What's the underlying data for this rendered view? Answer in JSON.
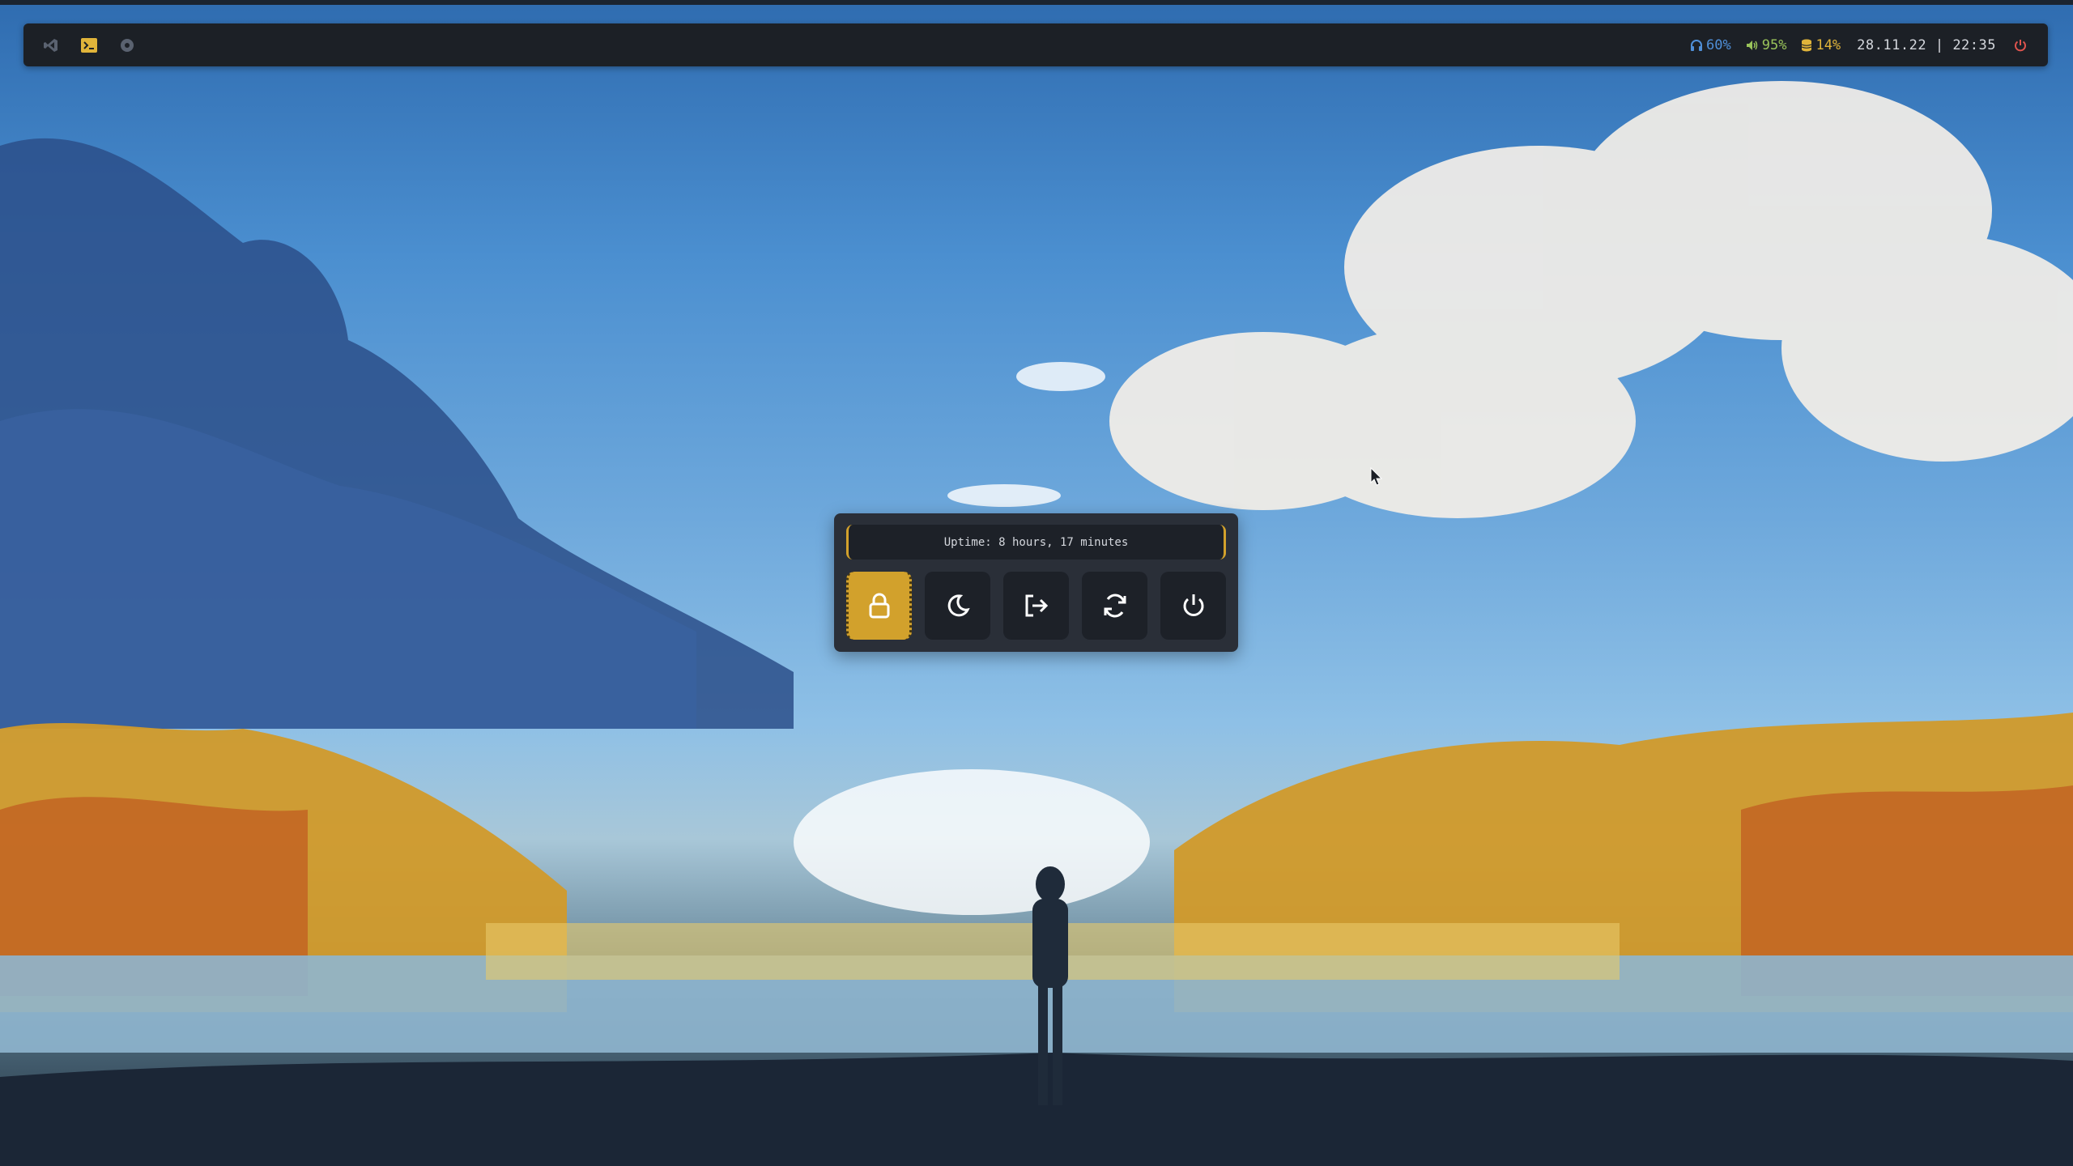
{
  "topbar": {
    "workspaces": [
      {
        "icon": "vscode-icon",
        "color": "#5a6270"
      },
      {
        "icon": "terminal-icon",
        "color": "#e0b43a"
      },
      {
        "icon": "browser-icon",
        "color": "#5a6270"
      }
    ],
    "modules": [
      {
        "icon": "headphones-icon",
        "value": "60%",
        "color": "#4f8fd8"
      },
      {
        "icon": "volume-icon",
        "value": "95%",
        "color": "#9ac45a"
      },
      {
        "icon": "database-icon",
        "value": "14%",
        "color": "#e0b43a"
      }
    ],
    "date": "28.11.22",
    "separator": "|",
    "time": "22:35",
    "power_color": "#e0544e"
  },
  "powermenu": {
    "uptime": "Uptime: 8 hours, 17 minutes",
    "actions": [
      {
        "name": "lock",
        "icon": "lock-icon",
        "active": true
      },
      {
        "name": "suspend",
        "icon": "moon-icon",
        "active": false
      },
      {
        "name": "logout",
        "icon": "logout-icon",
        "active": false
      },
      {
        "name": "reboot",
        "icon": "reboot-icon",
        "active": false
      },
      {
        "name": "shutdown",
        "icon": "power-icon",
        "active": false
      }
    ]
  }
}
